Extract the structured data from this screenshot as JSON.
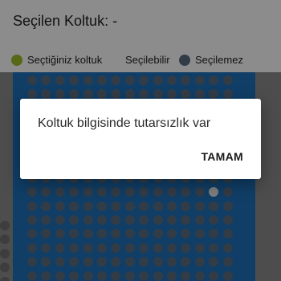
{
  "header": {
    "title": "Seçilen Koltuk: -"
  },
  "legend": {
    "items": [
      {
        "label": "Seçtiğiniz koltuk",
        "color": "#9ebd2a"
      },
      {
        "label": "Seçilebilir",
        "color": "#ffffff"
      },
      {
        "label": "Seçilemez",
        "color": "#5b6e82"
      }
    ]
  },
  "seat_map": {
    "area_color": "#1e72bc",
    "unavailable_color": "#5b6e82",
    "available_color": "#e6e6e6"
  },
  "dialog": {
    "message": "Koltuk bilgisinde tutarsızlık var",
    "ok_label": "TAMAM"
  }
}
